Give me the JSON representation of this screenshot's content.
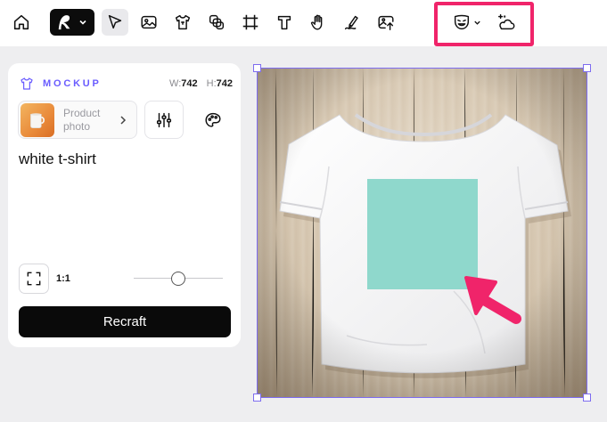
{
  "toolbar": {
    "tools": [
      {
        "name": "home-button",
        "icon": "home-icon"
      },
      {
        "name": "select-tool-button",
        "icon": "cursor-arrow-icon"
      },
      {
        "name": "image-tool-button",
        "icon": "image-icon"
      },
      {
        "name": "mockup-tool-button",
        "icon": "tshirt-icon"
      },
      {
        "name": "layers-tool-button",
        "icon": "layers-icon"
      },
      {
        "name": "frame-tool-button",
        "icon": "frame-icon"
      },
      {
        "name": "text-tool-button",
        "icon": "text-icon"
      },
      {
        "name": "hand-tool-button",
        "icon": "hand-icon"
      },
      {
        "name": "pen-tool-button",
        "icon": "pen-icon"
      },
      {
        "name": "export-tool-button",
        "icon": "image-upload-icon"
      },
      {
        "name": "mask-menu-button",
        "icon": "theater-mask-icon"
      },
      {
        "name": "ai-tools-button",
        "icon": "cloud-sparkle-icon"
      }
    ],
    "highlight_color": "#f0246a"
  },
  "panel": {
    "title": "MOCKUP",
    "width_label": "W:",
    "width_value": "742",
    "height_label": "H:",
    "height_value": "742",
    "style_card": {
      "line1": "Product",
      "line2": "photo"
    },
    "prompt": "white t-shirt",
    "ratio": "1:1",
    "slider_value": 0.5,
    "action_label": "Recraft"
  },
  "canvas": {
    "selection_color": "#7d6cf0",
    "overlay_color": "#8fd8cc",
    "arrow_color": "#f0246a"
  },
  "colors": {
    "accent": "#6a5cff",
    "primary_button": "#0a0a0a"
  }
}
